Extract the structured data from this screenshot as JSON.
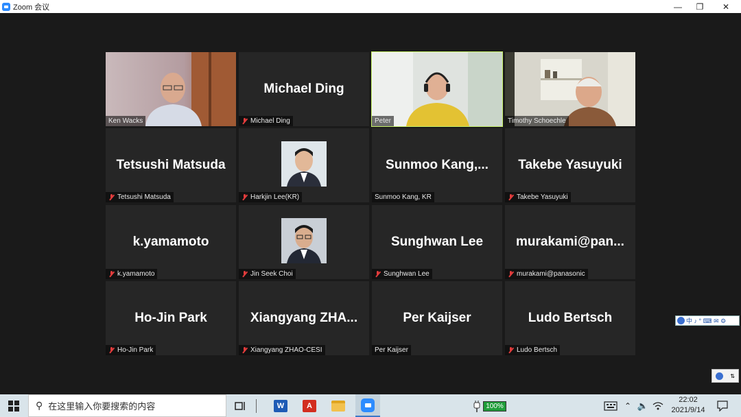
{
  "window": {
    "title": "Zoom 会议"
  },
  "tiles": [
    {
      "name": "Ken Wacks",
      "big": "",
      "muted": false,
      "type": "video"
    },
    {
      "name": "Michael Ding",
      "big": "Michael Ding",
      "muted": true,
      "type": "name"
    },
    {
      "name": "Peter",
      "big": "",
      "muted": false,
      "type": "video",
      "active": true
    },
    {
      "name": "Timothy Schoechle",
      "big": "",
      "muted": false,
      "type": "video"
    },
    {
      "name": "Tetsushi Matsuda",
      "big": "Tetsushi Matsuda",
      "muted": true,
      "type": "name"
    },
    {
      "name": "Harkjin Lee(KR)",
      "big": "",
      "muted": true,
      "type": "photo"
    },
    {
      "name": "Sunmoo Kang, KR",
      "big": "Sunmoo  Kang,...",
      "muted": false,
      "type": "name"
    },
    {
      "name": "Takebe Yasuyuki",
      "big": "Takebe Yasuyuki",
      "muted": true,
      "type": "name"
    },
    {
      "name": "k.yamamoto",
      "big": "k.yamamoto",
      "muted": true,
      "type": "name"
    },
    {
      "name": "Jin Seek Choi",
      "big": "",
      "muted": true,
      "type": "photo"
    },
    {
      "name": "Sunghwan Lee",
      "big": "Sunghwan Lee",
      "muted": true,
      "type": "name"
    },
    {
      "name": "murakami@panasonic",
      "big": "murakami@pan...",
      "muted": true,
      "type": "name"
    },
    {
      "name": "Ho-Jin Park",
      "big": "Ho-Jin Park",
      "muted": true,
      "type": "name"
    },
    {
      "name": "Xiangyang ZHAO-CESI",
      "big": "Xiangyang  ZHA...",
      "muted": true,
      "type": "name"
    },
    {
      "name": "Per Kaijser",
      "big": "Per Kaijser",
      "muted": false,
      "type": "name"
    },
    {
      "name": "Ludo Bertsch",
      "big": "Ludo Bertsch",
      "muted": true,
      "type": "name"
    }
  ],
  "ime": {
    "text": "中 ♪ ° ⌨ ✉ ⚙"
  },
  "taskbar": {
    "search_placeholder": "在这里输入你要搜索的内容",
    "battery": "100%",
    "time": "22:02",
    "date": "2021/9/14"
  },
  "colors": {
    "active_border": "#c7f267",
    "muted_icon": "#e23c3c",
    "tile_bg": "#262626"
  }
}
